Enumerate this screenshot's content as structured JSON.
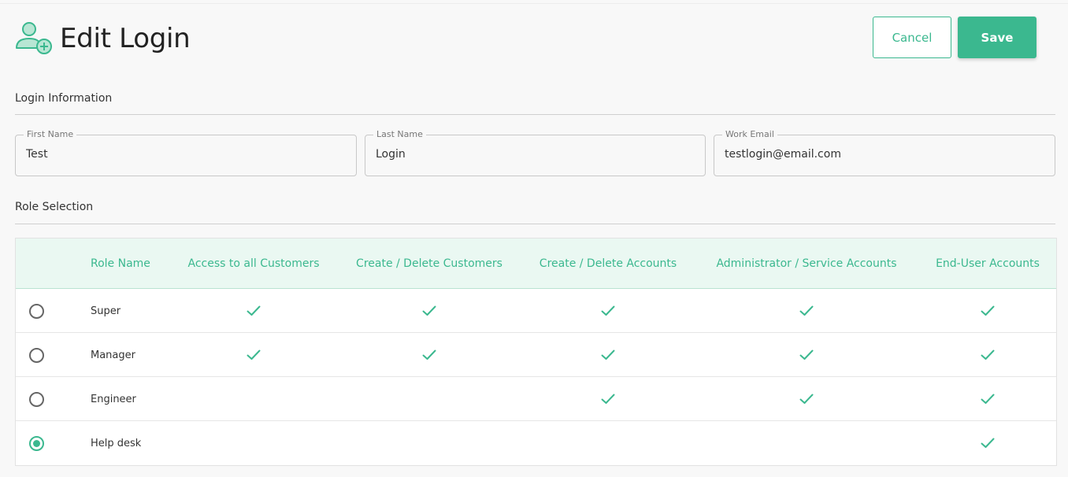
{
  "header": {
    "title": "Edit Login",
    "icon": "user-add-icon",
    "cancel_label": "Cancel",
    "save_label": "Save"
  },
  "login_info": {
    "section_title": "Login Information",
    "first_name": {
      "label": "First Name",
      "value": "Test"
    },
    "last_name": {
      "label": "Last Name",
      "value": "Login"
    },
    "work_email": {
      "label": "Work Email",
      "value": "testlogin@email.com"
    }
  },
  "role_selection": {
    "section_title": "Role Selection",
    "columns": [
      "Role Name",
      "Access to all Customers",
      "Create / Delete Customers",
      "Create / Delete Accounts",
      "Administrator / Service Accounts",
      "End-User Accounts"
    ],
    "rows": [
      {
        "name": "Super",
        "selected": false,
        "permissions": [
          true,
          true,
          true,
          true,
          true
        ]
      },
      {
        "name": "Manager",
        "selected": false,
        "permissions": [
          true,
          true,
          true,
          true,
          true
        ]
      },
      {
        "name": "Engineer",
        "selected": false,
        "permissions": [
          false,
          false,
          true,
          true,
          true
        ]
      },
      {
        "name": "Help desk",
        "selected": true,
        "permissions": [
          false,
          false,
          false,
          false,
          true
        ]
      }
    ]
  },
  "colors": {
    "accent": "#3bb88f",
    "header_bg": "#eaf8f2"
  }
}
